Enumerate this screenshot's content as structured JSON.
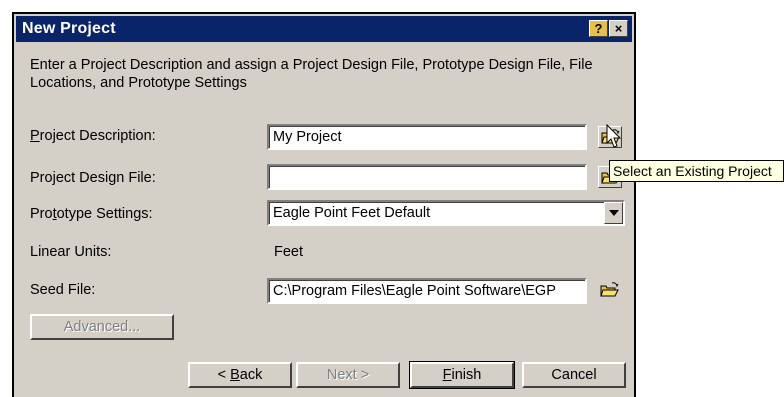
{
  "window": {
    "title": "New Project",
    "help_label": "?",
    "close_label": "×"
  },
  "intro": "Enter a Project Description and assign a Project Design File, Prototype Design File, File Locations, and Prototype Settings",
  "fields": {
    "project_description": {
      "label_key": "P",
      "label_rest": "roject Description:",
      "value": "My Project"
    },
    "project_design_file": {
      "label_pre": "Pro",
      "label_key": "j",
      "label_rest": "ect Design File:",
      "value": ""
    },
    "prototype_settings": {
      "label_pre": "Pro",
      "label_key": "t",
      "label_rest": "otype Settings:",
      "value": "Eagle Point Feet Default"
    },
    "linear_units": {
      "label": "Linear Units:",
      "value": "Feet"
    },
    "seed_file": {
      "label": "Seed File:",
      "value": "C:\\Program Files\\Eagle Point Software\\EGP"
    }
  },
  "tooltip": "Select an Existing Project",
  "buttons": {
    "advanced": "Advanced...",
    "back_pre": "< ",
    "back_key": "B",
    "back_rest": "ack",
    "next": "Next >",
    "finish_key": "F",
    "finish_rest": "inish",
    "cancel": "Cancel"
  },
  "icons": {
    "browse_project": "open-folder-icon",
    "browse_design": "open-folder-icon",
    "browse_seed": "open-folder-icon",
    "cursor": "mouse-pointer-icon"
  },
  "colors": {
    "titlebar": "#0a246a",
    "dialog_face": "#d4d0c8",
    "tooltip_bg": "#ffffe1"
  }
}
